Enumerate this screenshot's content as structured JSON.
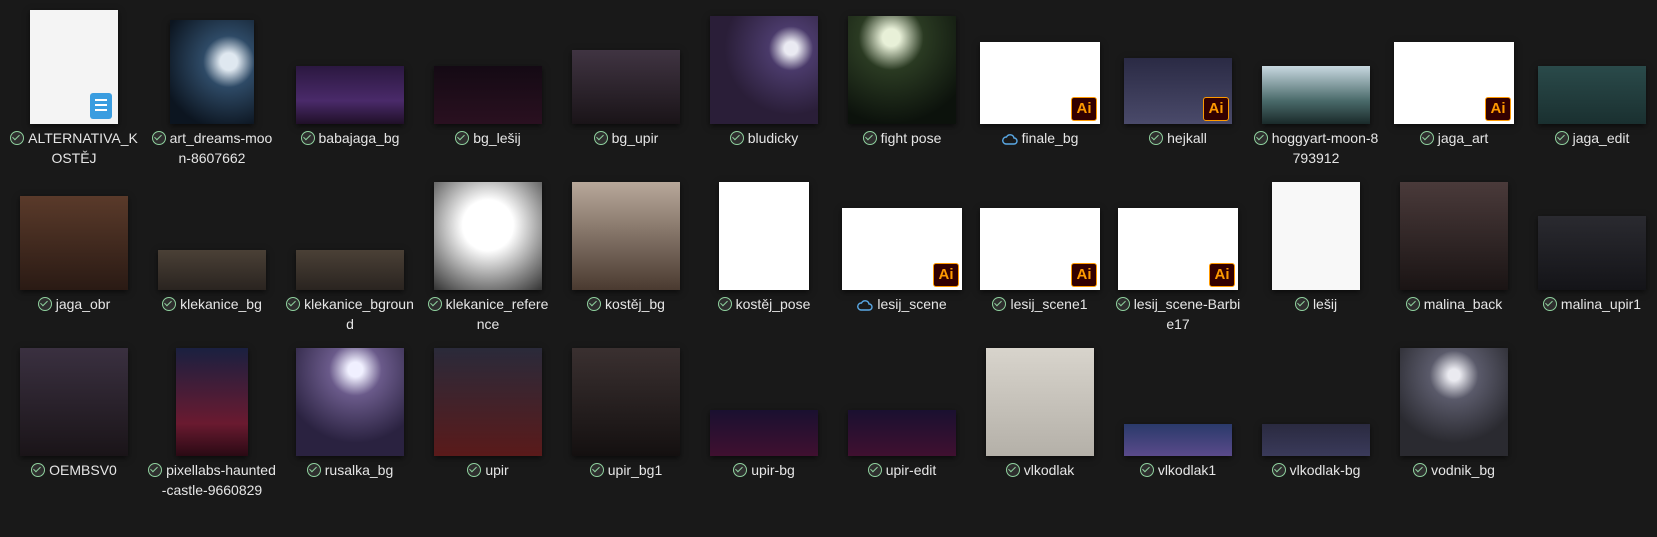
{
  "explorer": {
    "items": [
      {
        "name": "ALTERNATIVA_KOSTĚJ",
        "status": "synced",
        "badge": "doc"
      },
      {
        "name": "art_dreams-moon-8607662",
        "status": "synced",
        "badge": ""
      },
      {
        "name": "babajaga_bg",
        "status": "synced",
        "badge": ""
      },
      {
        "name": "bg_lešij",
        "status": "synced",
        "badge": ""
      },
      {
        "name": "bg_upir",
        "status": "synced",
        "badge": ""
      },
      {
        "name": "bludicky",
        "status": "synced",
        "badge": ""
      },
      {
        "name": "fight pose",
        "status": "synced",
        "badge": ""
      },
      {
        "name": "finale_bg",
        "status": "cloud",
        "badge": "Ai"
      },
      {
        "name": "hejkall",
        "status": "synced",
        "badge": "Ai"
      },
      {
        "name": "hoggyart-moon-8793912",
        "status": "synced",
        "badge": ""
      },
      {
        "name": "jaga_art",
        "status": "synced",
        "badge": "Ai"
      },
      {
        "name": "jaga_edit",
        "status": "synced",
        "badge": ""
      },
      {
        "name": "jaga_obr",
        "status": "synced",
        "badge": ""
      },
      {
        "name": "klekanice_bg",
        "status": "synced",
        "badge": ""
      },
      {
        "name": "klekanice_bground",
        "status": "synced",
        "badge": ""
      },
      {
        "name": "klekanice_reference",
        "status": "synced",
        "badge": ""
      },
      {
        "name": "kostěj_bg",
        "status": "synced",
        "badge": ""
      },
      {
        "name": "kostěj_pose",
        "status": "synced",
        "badge": ""
      },
      {
        "name": "lesij_scene",
        "status": "cloud",
        "badge": "Ai"
      },
      {
        "name": "lesij_scene1",
        "status": "synced",
        "badge": "Ai"
      },
      {
        "name": "lesij_scene-Barbie17",
        "status": "synced",
        "badge": "Ai"
      },
      {
        "name": "lešij",
        "status": "synced",
        "badge": ""
      },
      {
        "name": "malina_back",
        "status": "synced",
        "badge": ""
      },
      {
        "name": "malina_upir1",
        "status": "synced",
        "badge": ""
      },
      {
        "name": "OEMBSV0",
        "status": "synced",
        "badge": ""
      },
      {
        "name": "pixellabs-haunted-castle-9660829",
        "status": "synced",
        "badge": ""
      },
      {
        "name": "rusalka_bg",
        "status": "synced",
        "badge": ""
      },
      {
        "name": "upir",
        "status": "synced",
        "badge": ""
      },
      {
        "name": "upir_bg1",
        "status": "synced",
        "badge": ""
      },
      {
        "name": "upir-bg",
        "status": "synced",
        "badge": ""
      },
      {
        "name": "upir-edit",
        "status": "synced",
        "badge": ""
      },
      {
        "name": "vlkodlak",
        "status": "synced",
        "badge": ""
      },
      {
        "name": "vlkodlak1",
        "status": "synced",
        "badge": ""
      },
      {
        "name": "vlkodlak-bg",
        "status": "synced",
        "badge": ""
      },
      {
        "name": "vodnik_bg",
        "status": "synced",
        "badge": ""
      }
    ]
  },
  "colors": {
    "background": "#191919",
    "synced_check": "#8fd19e",
    "cloud": "#5aa9e6",
    "ai_orange": "#ff9a00"
  }
}
